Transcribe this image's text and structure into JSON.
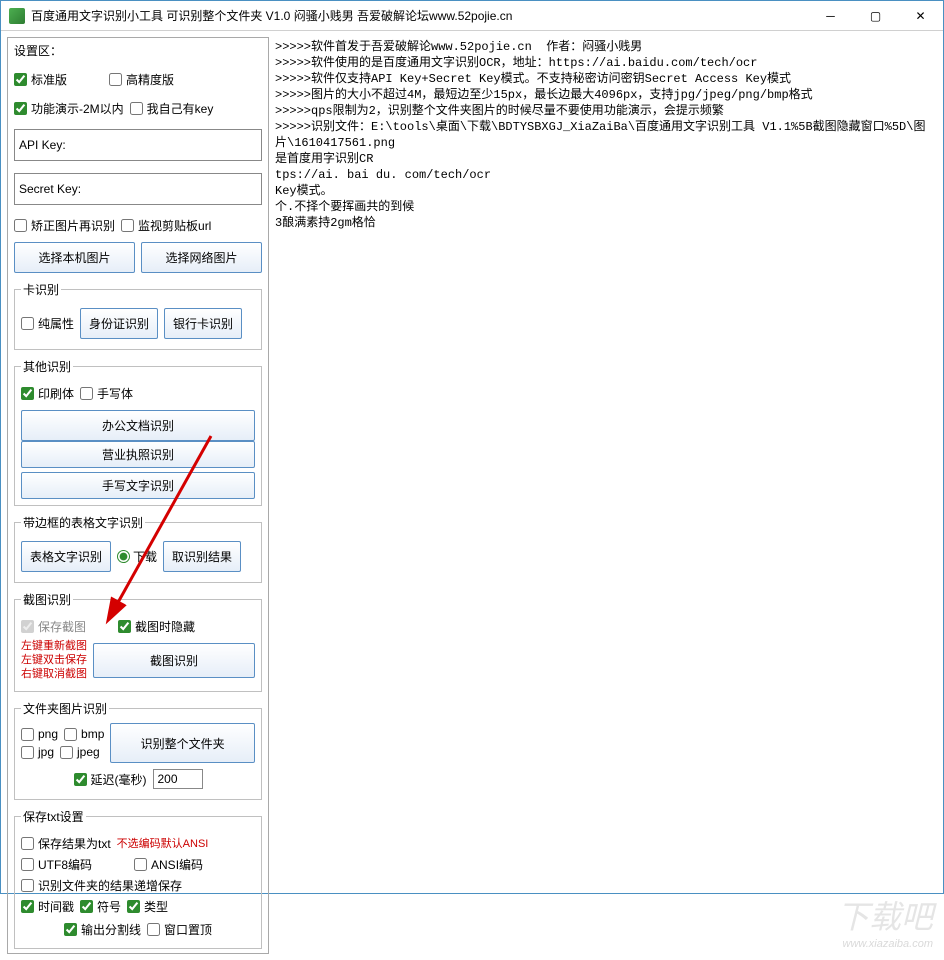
{
  "window": {
    "title": "百度通用文字识别小工具 可识别整个文件夹 V1.0  闷骚小贱男   吾爱破解论坛www.52pojie.cn"
  },
  "settings_label": "设置区：",
  "top_checks": {
    "standard": "标准版",
    "high_precision": "高精度版",
    "demo_2m": "功能演示-2M以内",
    "own_key": "我自己有key"
  },
  "api": {
    "api_key_label": "API Key:",
    "api_key_value": "",
    "secret_key_label": "Secret Key:",
    "secret_key_value": ""
  },
  "misc_checks": {
    "rerecognize": "矫正图片再识别",
    "monitor_clip": "监视剪贴板url"
  },
  "img_buttons": {
    "local": "选择本机图片",
    "net": "选择网络图片"
  },
  "card_group": {
    "title": "卡识别",
    "pure": "纯属性",
    "id": "身份证识别",
    "bank": "银行卡识别"
  },
  "other_group": {
    "title": "其他识别",
    "print": "印刷体",
    "hand": "手写体",
    "office": "办公文档识别",
    "license": "营业执照识别",
    "handwrite": "手写文字识别"
  },
  "table_group": {
    "title": "带边框的表格文字识别",
    "table_ocr": "表格文字识别",
    "download": "下载",
    "get_result": "取识别结果"
  },
  "shot_group": {
    "title": "截图识别",
    "save_shot": "保存截图",
    "hide_on_shot": "截图时隐藏",
    "hint1": "左键重新截图",
    "hint2": "左键双击保存",
    "hint3": "右键取消截图",
    "shot_btn": "截图识别"
  },
  "folder_group": {
    "title": "文件夹图片识别",
    "png": "png",
    "bmp": "bmp",
    "jpg": "jpg",
    "jpeg": "jpeg",
    "recognize_folder": "识别整个文件夹",
    "delay_label": "延迟(毫秒)",
    "delay_value": "200"
  },
  "txt_group": {
    "title": "保存txt设置",
    "save_as_txt": "保存结果为txt",
    "no_encoding_hint": "不选编码默认ANSI",
    "utf8": "UTF8编码",
    "ansi": "ANSI编码",
    "append": "识别文件夹的结果递增保存",
    "timestamp": "时间戳",
    "symbol": "符号",
    "type": "类型",
    "sep_line": "输出分割线",
    "topmost": "窗口置顶"
  },
  "log": ">>>>>软件首发于吾爱破解论www.52pojie.cn  作者：闷骚小贱男\n>>>>>软件使用的是百度通用文字识别OCR，地址：https://ai.baidu.com/tech/ocr\n>>>>>软件仅支持API Key+Secret Key模式。不支持秘密访问密钥Secret Access Key模式\n>>>>>图片的大小不超过4M，最短边至少15px，最长边最大4096px，支持jpg/jpeg/png/bmp格式\n>>>>>qps限制为2，识别整个文件夹图片的时候尽量不要使用功能演示，会提示频繁\n>>>>>识别文件：E:\\tools\\桌面\\下载\\BDTYSBXGJ_XiaZaiBa\\百度通用文字识别工具 V1.1%5B截图隐藏窗口%5D\\图片\\1610417561.png\n是首度用字识别CR\ntps://ai. bai du. com/tech/ocr\nKey模式。\n个.不择个要挥画共的到候\n3酿满素持2gm格恰",
  "watermark": {
    "main": "下载吧",
    "sub": "www.xiazaiba.com"
  }
}
